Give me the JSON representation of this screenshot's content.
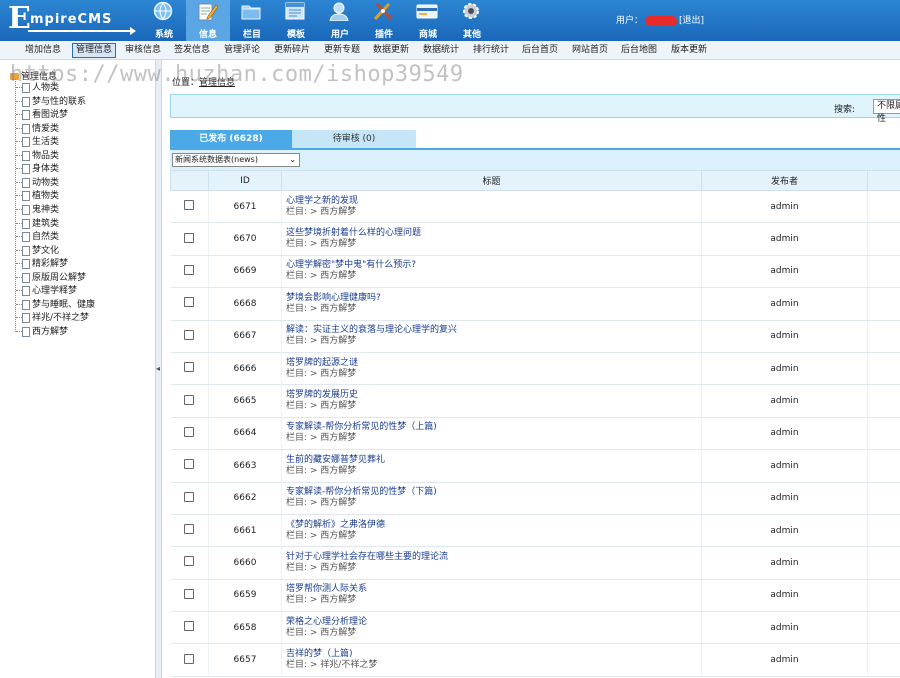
{
  "logo": {
    "initial": "E",
    "rest": "mpireCMS"
  },
  "top_nav": [
    {
      "label": "系统",
      "icon": "globe-icon"
    },
    {
      "label": "信息",
      "icon": "edit-icon"
    },
    {
      "label": "栏目",
      "icon": "folder-icon"
    },
    {
      "label": "模板",
      "icon": "template-icon"
    },
    {
      "label": "用户",
      "icon": "user-icon"
    },
    {
      "label": "插件",
      "icon": "tools-icon"
    },
    {
      "label": "商城",
      "icon": "card-icon"
    },
    {
      "label": "其他",
      "icon": "gear-icon"
    }
  ],
  "user": {
    "prefix": "用户：",
    "logout": "[退出]"
  },
  "menu": [
    "增加信息",
    "管理信息",
    "审核信息",
    "签发信息",
    "管理评论",
    "更新碎片",
    "更新专题",
    "数据更新",
    "数据统计",
    "排行统计",
    "后台首页",
    "网站首页",
    "后台地图",
    "版本更新"
  ],
  "sidebar": {
    "root": "管理信息",
    "items": [
      "人物类",
      "梦与性的联系",
      "看图说梦",
      "情爱类",
      "生活类",
      "物品类",
      "身体类",
      "动物类",
      "植物类",
      "鬼神类",
      "建筑类",
      "自然类",
      "梦文化",
      "精彩解梦",
      "原版周公解梦",
      "心理学释梦",
      "梦与睡眠、健康",
      "祥兆/不祥之梦",
      "西方解梦"
    ]
  },
  "location": {
    "label": "位置：",
    "link": "管理信息"
  },
  "search": {
    "label": "搜索:",
    "scope": "不限属性"
  },
  "tabs": {
    "published": "已发布 (6628)",
    "pending": "待审核 (0)"
  },
  "db_select": "新闻系统数据表(news)",
  "table": {
    "headers": {
      "id": "ID",
      "title": "标题",
      "publisher": "发布者"
    },
    "rows": [
      {
        "id": "6671",
        "title": "心理学之新的发现",
        "column": "栏目: > 西方解梦",
        "publisher": "admin"
      },
      {
        "id": "6670",
        "title": "这些梦境折射着什么样的心理问题",
        "column": "栏目: > 西方解梦",
        "publisher": "admin"
      },
      {
        "id": "6669",
        "title": "心理学解密\"梦中鬼\"有什么预示?",
        "column": "栏目: > 西方解梦",
        "publisher": "admin"
      },
      {
        "id": "6668",
        "title": "梦境会影响心理健康吗?",
        "column": "栏目: > 西方解梦",
        "publisher": "admin"
      },
      {
        "id": "6667",
        "title": "解读：实证主义的衰落与理论心理学的复兴",
        "column": "栏目: > 西方解梦",
        "publisher": "admin"
      },
      {
        "id": "6666",
        "title": "塔罗牌的起源之谜",
        "column": "栏目: > 西方解梦",
        "publisher": "admin"
      },
      {
        "id": "6665",
        "title": "塔罗牌的发展历史",
        "column": "栏目: > 西方解梦",
        "publisher": "admin"
      },
      {
        "id": "6664",
        "title": "专家解读-帮你分析常见的性梦（上篇)",
        "column": "栏目: > 西方解梦",
        "publisher": "admin"
      },
      {
        "id": "6663",
        "title": "生前的藏安娜普梦见葬礼",
        "column": "栏目: > 西方解梦",
        "publisher": "admin"
      },
      {
        "id": "6662",
        "title": "专家解读-帮你分析常见的性梦（下篇)",
        "column": "栏目: > 西方解梦",
        "publisher": "admin"
      },
      {
        "id": "6661",
        "title": "《梦的解析》之弗洛伊德",
        "column": "栏目: > 西方解梦",
        "publisher": "admin"
      },
      {
        "id": "6660",
        "title": "针对于心理学社会存在哪些主要的理论流",
        "column": "栏目: > 西方解梦",
        "publisher": "admin"
      },
      {
        "id": "6659",
        "title": "塔罗帮你测人际关系",
        "column": "栏目: > 西方解梦",
        "publisher": "admin"
      },
      {
        "id": "6658",
        "title": "荣格之心理分析理论",
        "column": "栏目: > 西方解梦",
        "publisher": "admin"
      },
      {
        "id": "6657",
        "title": "吉祥的梦（上篇)",
        "column": "栏目: > 祥兆/不祥之梦",
        "publisher": "admin"
      }
    ]
  },
  "watermark": "https://www.huzhan.com/ishop39549",
  "colors": {
    "topbar": "#1f72c4",
    "tab_active": "#4aa9e6",
    "link": "#1b3d8f"
  }
}
